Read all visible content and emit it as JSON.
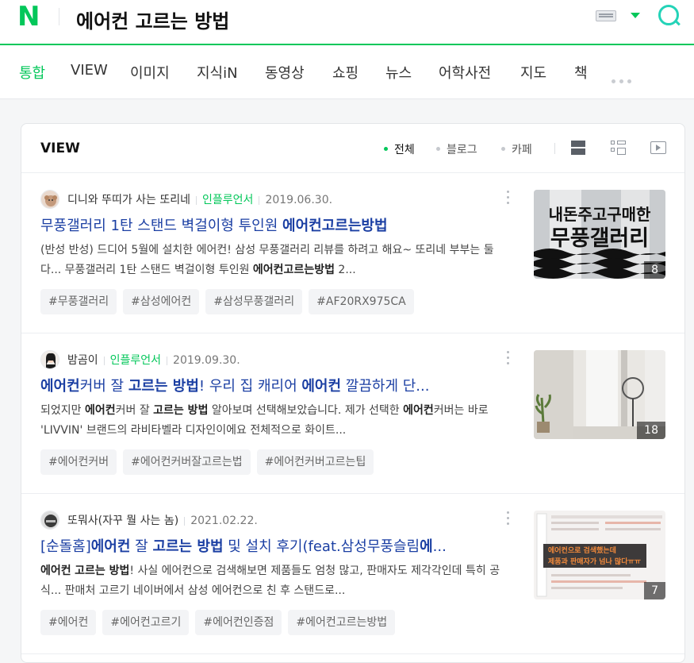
{
  "header": {
    "logo": "N",
    "query": "에어컨 고르는 방법"
  },
  "tabs": [
    {
      "label": "통합",
      "active": true
    },
    {
      "label": "VIEW"
    },
    {
      "label": "이미지"
    },
    {
      "label": "지식iN"
    },
    {
      "label": "동영상"
    },
    {
      "label": "쇼핑"
    },
    {
      "label": "뉴스"
    },
    {
      "label": "어학사전"
    },
    {
      "label": "지도"
    },
    {
      "label": "책"
    }
  ],
  "section": {
    "title": "VIEW",
    "filters": [
      "전체",
      "블로그",
      "카페"
    ]
  },
  "results": [
    {
      "author": "디니와 뚜띠가 사는 또리네",
      "badge": "인플루언서",
      "date": "2019.06.30.",
      "title_parts": [
        "무풍갤러리 1탄 스탠드 벽걸이형 투인원 ",
        "에어컨고르는방법"
      ],
      "desc_parts": [
        "(반성 반성) 드디어 5월에 설치한 에어컨! 삼성 무풍갤러리 리뷰를 하려고 해요~ 또리네 부부는 둘 다... 무풍갤러리 1탄 스탠드 벽걸이형 투인원 ",
        "에어컨고르는방법",
        " 2..."
      ],
      "tags": [
        "#무풍갤러리",
        "#삼성에어컨",
        "#삼성무풍갤러리",
        "#AF20RX975CA"
      ],
      "thumb_text": [
        "내돈주고구매한",
        "무풍갤러리"
      ],
      "thumb_count": "8"
    },
    {
      "author": "밤곰이",
      "badge": "인플루언서",
      "date": "2019.09.30.",
      "title_parts": [
        "에어컨",
        "커버 잘 ",
        "고르는 방법",
        "! 우리 집 캐리어 ",
        "에어컨",
        " 깔끔하게 단..."
      ],
      "desc_parts": [
        "되었지만 ",
        "에어컨",
        "커버 잘 ",
        "고르는 방법",
        " 알아보며 선택해보았습니다. 제가 선택한 ",
        "에어컨",
        "커버는 바로 'LIVVIN' 브랜드의 라비타벨라 디자인이에요 전체적으로 화이트..."
      ],
      "tags": [
        "#에어컨커버",
        "#에어컨커버잘고르는법",
        "#에어컨커버고르는팁"
      ],
      "thumb_count": "18"
    },
    {
      "author": "또뭐사(자꾸 뭘 사는 놈)",
      "date": "2021.02.22.",
      "title_parts": [
        "[순돌홈]",
        "에어컨",
        " 잘 ",
        "고르는 방법",
        " 및 설치 후기(feat.삼성무풍슬림",
        "에",
        "..."
      ],
      "desc_parts": [
        "에어컨",
        " ",
        "고르는 방법",
        "! 사실 에어컨으로 검색해보면 제품들도 엄청 많고, 판매자도 제각각인데 특히 공식... 판매처 고르기 네이버에서 삼성 에어컨으로 친 후 스탠드로..."
      ],
      "tags": [
        "#에어컨",
        "#에어컨고르기",
        "#에어컨인증점",
        "#에어컨고르는방법"
      ],
      "thumb_text": [
        "에어컨으로 검색했는데",
        "제품과 판매자가 넘나 많다ㅠㅠ"
      ],
      "thumb_count": "7"
    }
  ]
}
